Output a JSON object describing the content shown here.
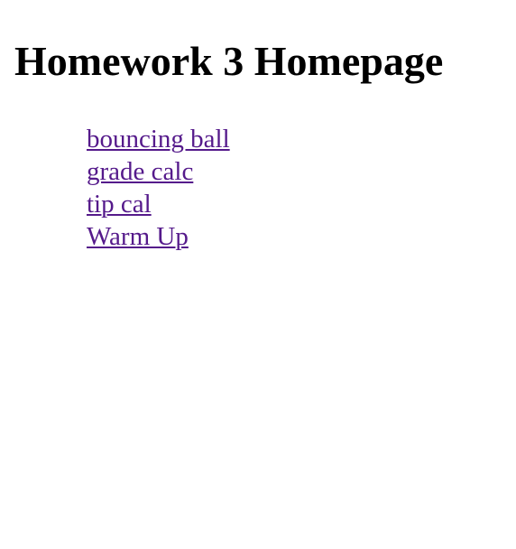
{
  "page": {
    "title": "Homework 3 Homepage"
  },
  "links": [
    {
      "label": "bouncing ball"
    },
    {
      "label": "grade calc"
    },
    {
      "label": "tip cal"
    },
    {
      "label": "Warm Up"
    }
  ],
  "colors": {
    "visited_link": "#551a8b",
    "text": "#000000",
    "background": "#ffffff"
  }
}
